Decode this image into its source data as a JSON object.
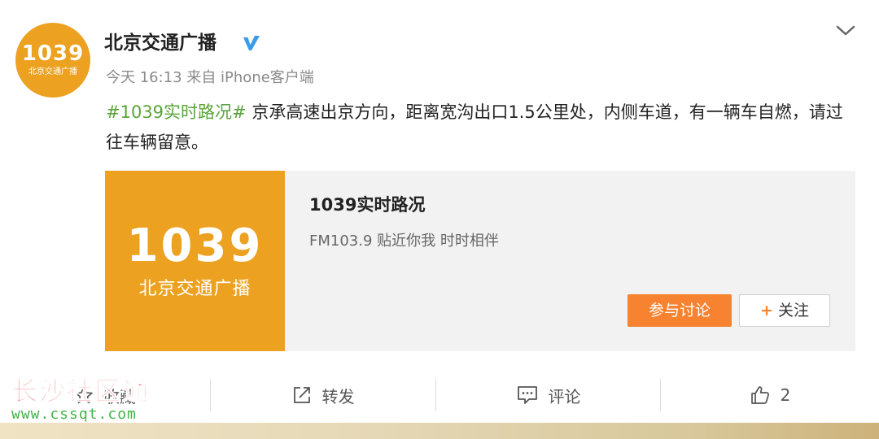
{
  "account": {
    "avatar_number": "1039",
    "avatar_subtitle": "北京交通广播",
    "name": "北京交通广播"
  },
  "meta": "今天 16:13 来自 iPhone客户端",
  "post": {
    "hashtag": "#1039实时路况#",
    "text": " 京承高速出京方向，距离宽沟出口1.5公里处，内侧车道，有一辆车自燃，请过往车辆留意。"
  },
  "card": {
    "image_number": "1039",
    "image_subtitle": "北京交通广播",
    "title": "1039实时路况",
    "description": "FM103.9 贴近你我 时时相伴",
    "discuss_label": "参与讨论",
    "follow_label": "关注"
  },
  "actions": {
    "favorite_label": "收藏",
    "repost_label": "转发",
    "comment_label": "评论",
    "like_count": "2"
  },
  "watermark": {
    "title": "长沙社区通",
    "url": "www.cssqt.com"
  },
  "colors": {
    "brand_orange": "#eca121",
    "hashtag_green": "#5aa43b",
    "discuss_button": "#f7822f",
    "verified_blue": "#3a9be8"
  }
}
